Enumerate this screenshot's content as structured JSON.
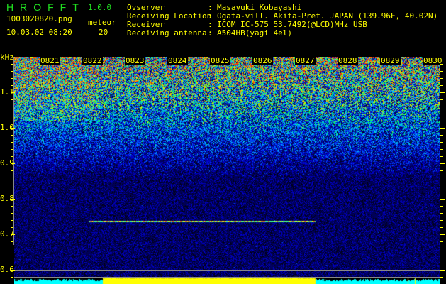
{
  "app": {
    "title": "HROFFT",
    "version": "1.0.0"
  },
  "file": {
    "name": "1003020820.png",
    "datetime": "10.03.02 08:20"
  },
  "meteor": {
    "label": "meteor",
    "count": "20"
  },
  "info": [
    {
      "label": "Ovserver",
      "sep": ":",
      "value": "Masayuki Kobayashi"
    },
    {
      "label": "Receiving Location",
      "sep": ":",
      "value": "Ogata-vill. Akita-Pref. JAPAN (139.96E, 40.02N)"
    },
    {
      "label": "Receiver",
      "sep": ":",
      "value": "ICOM IC-575 53.7492(@LCD)MHz USB"
    },
    {
      "label": "Receiving antenna",
      "sep": ":",
      "value": "A504HB(yagi 4el)"
    }
  ],
  "axis": {
    "unit": "kHz",
    "y_labels": [
      "1.1",
      "1.0",
      "0.9",
      "0.8",
      "0.7",
      "0.6"
    ],
    "time_labels": [
      "0821",
      "0822",
      "0823",
      "0824",
      "0825",
      "0826",
      "0827",
      "0828",
      "0829",
      "0830"
    ]
  },
  "colors": {
    "text": "#ffff00",
    "title": "#20e020",
    "bar_low": "#00ffff",
    "bar_high": "#ffff00"
  }
}
